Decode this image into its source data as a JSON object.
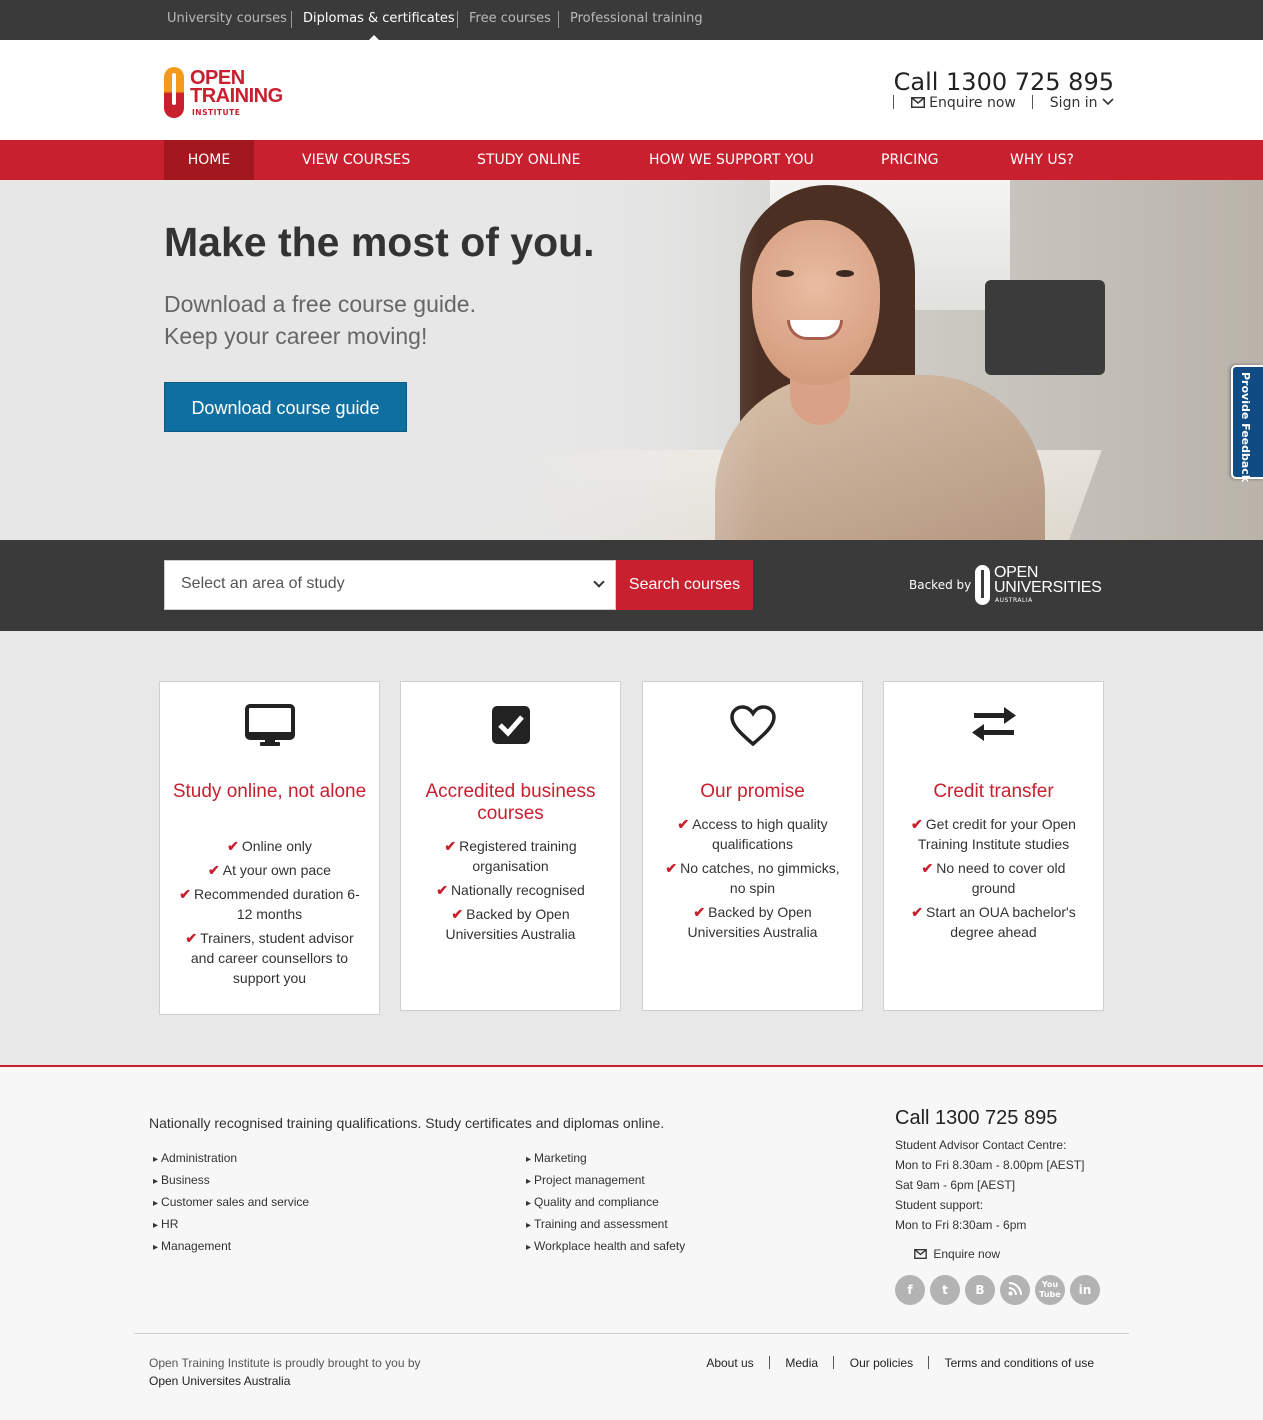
{
  "topbar": {
    "items": [
      "University courses",
      "Diplomas & certificates",
      "Free courses",
      "Professional training"
    ],
    "active_index": 1
  },
  "header": {
    "logo": {
      "line1": "OPEN",
      "line2": "TRAINING",
      "line3": "INSTITUTE"
    },
    "phone": "Call 1300 725 895",
    "enquire": "Enquire now",
    "signin": "Sign in"
  },
  "nav": {
    "items": [
      "HOME",
      "VIEW COURSES",
      "STUDY ONLINE",
      "HOW WE SUPPORT YOU",
      "PRICING",
      "WHY US?"
    ],
    "active_index": 0
  },
  "hero": {
    "title": "Make the most of you.",
    "sub1": "Download a free course guide.",
    "sub2": "Keep your career moving!",
    "button": "Download course guide"
  },
  "feedback_tab": "Provide Feedback",
  "search": {
    "select_value": "Select an area of study",
    "button": "Search courses",
    "backed_by": "Backed by",
    "partner": {
      "line1": "OPEN",
      "line2": "UNIVERSITIES",
      "line3": "AUSTRALIA"
    }
  },
  "features": [
    {
      "icon": "monitor-icon",
      "title": "Study online, not alone",
      "items": [
        "Online only",
        "At your own pace",
        "Recommended duration 6-12 months",
        "Trainers, student advisor and career counsellors to support you"
      ]
    },
    {
      "icon": "checkbox-icon",
      "title": "Accredited business courses",
      "items": [
        "Registered training organisation",
        "Nationally recognised",
        "Backed by Open Universities Australia"
      ]
    },
    {
      "icon": "heart-icon",
      "title": "Our promise",
      "items": [
        "Access to high quality qualifications",
        "No catches, no gimmicks, no spin",
        "Backed by Open Universities Australia"
      ]
    },
    {
      "icon": "transfer-arrows-icon",
      "title": "Credit transfer",
      "items": [
        "Get credit for your Open Training Institute studies",
        "No need to cover old ground",
        "Start an OUA bachelor's degree ahead"
      ]
    }
  ],
  "footer": {
    "tagline": "Nationally recognised training qualifications. Study certificates and diplomas online.",
    "col1": [
      "Administration",
      "Business",
      "Customer sales and service",
      "HR",
      "Management"
    ],
    "col2": [
      "Marketing",
      "Project management",
      "Quality and compliance",
      "Training and assessment",
      "Workplace health and safety"
    ],
    "phone": "Call 1300 725 895",
    "hours": [
      "Student Advisor Contact Centre:",
      "Mon to Fri 8.30am - 8.00pm [AEST]",
      "Sat 9am - 6pm [AEST]",
      "Student support:",
      "Mon to Fri 8:30am - 6pm"
    ],
    "enquire": "Enquire now",
    "social": [
      "facebook-icon",
      "twitter-icon",
      "blogger-icon",
      "rss-icon",
      "youtube-icon",
      "linkedin-icon"
    ],
    "brought_by_line1": "Open Training Institute is proudly brought to you by",
    "brought_by_line2": "Open Universites Australia",
    "links": [
      "About us",
      "Media",
      "Our policies",
      "Terms and conditions of use"
    ]
  }
}
